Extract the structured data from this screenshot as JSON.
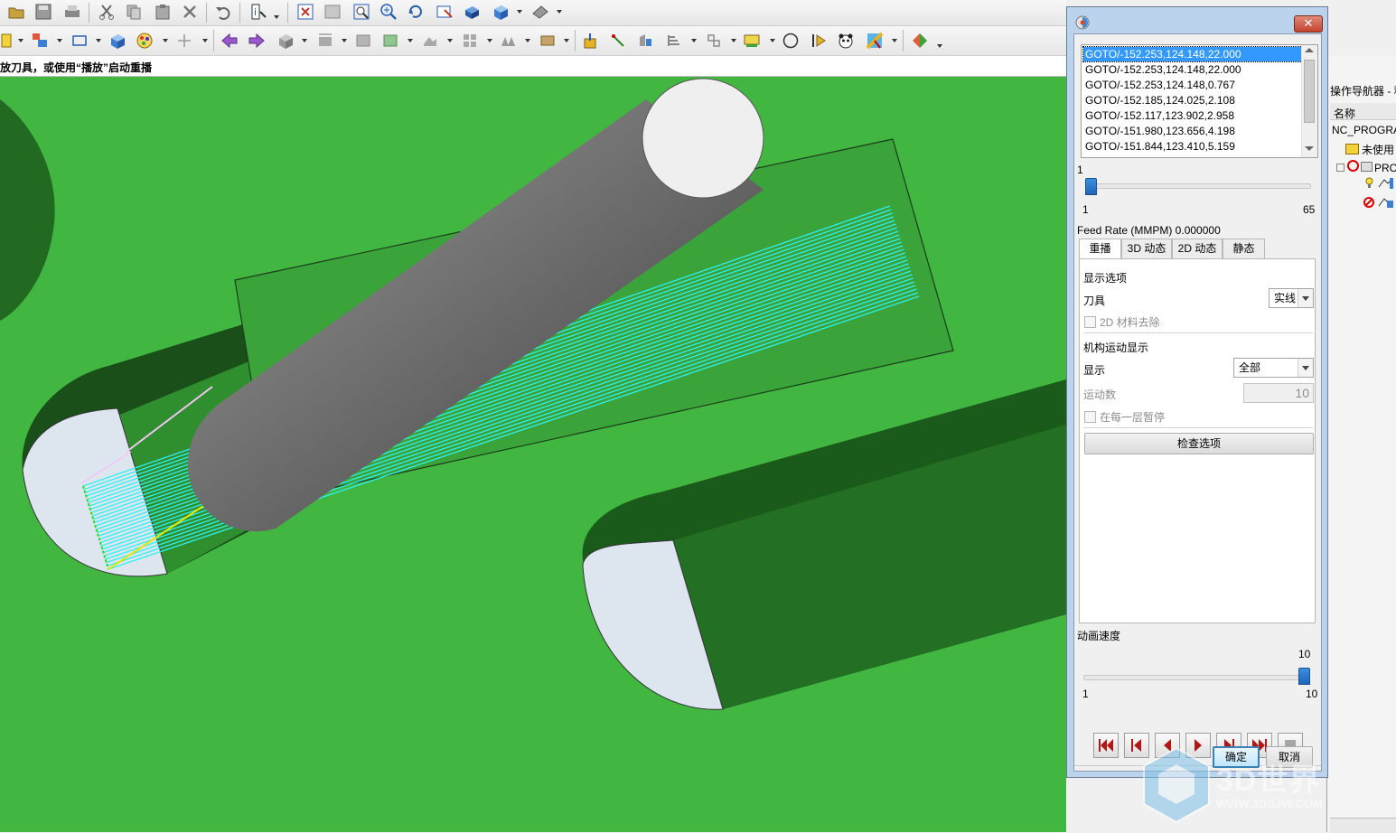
{
  "status_bar": {
    "message": "放刀具，或使用“播放”启动重播"
  },
  "navigator": {
    "title": "操作导航器 - 程",
    "column_name": "名称",
    "rows": [
      "NC_PROGRAM",
      "未使用",
      "PRO"
    ]
  },
  "dialog": {
    "close_label": "✕",
    "goto_list": [
      "GOTO/-152.253,124.148,22.000",
      "GOTO/-152.253,124.148,22.000",
      "GOTO/-152.253,124.148,0.767",
      "GOTO/-152.185,124.025,2.108",
      "GOTO/-152.117,123.902,2.958",
      "GOTO/-151.980,123.656,4.198",
      "GOTO/-151.844,123.410,5.159"
    ],
    "selected_index": 0,
    "position_slider": {
      "value_label": "1",
      "min_label": "1",
      "max_label": "65",
      "value_fraction": 0.0
    },
    "feed_rate": "Feed Rate (MMPM) 0.000000",
    "tabs": [
      "重播",
      "3D 动态",
      "2D 动态",
      "静态"
    ],
    "active_tab": 0,
    "display_options_header": "显示选项",
    "tool_label": "刀具",
    "tool_value": "实线",
    "material_removal_2d": "2D 材料去除",
    "mechanism_header": "机构运动显示",
    "display_label": "显示",
    "display_value": "全部",
    "motion_count_label": "运动数",
    "motion_count_value": "10",
    "pause_each_layer": "在每一层暂停",
    "check_options_button": "检查选项",
    "animation_speed_label": "动画速度",
    "speed_slider": {
      "value_label": "10",
      "min_label": "1",
      "max_label": "10",
      "value_fraction": 1.0
    },
    "ok_button": "确定",
    "cancel_button": "取消"
  },
  "watermark": {
    "text": "3D世界",
    "sub": "WWW.3DSJW.COM"
  },
  "colors": {
    "viewport_green": "#41b641",
    "toolpath_cyan": "#2ff0f0",
    "selection_blue": "#3399ff",
    "dialog_frame": "#bcd3ee",
    "playback_red": "#b01818"
  }
}
